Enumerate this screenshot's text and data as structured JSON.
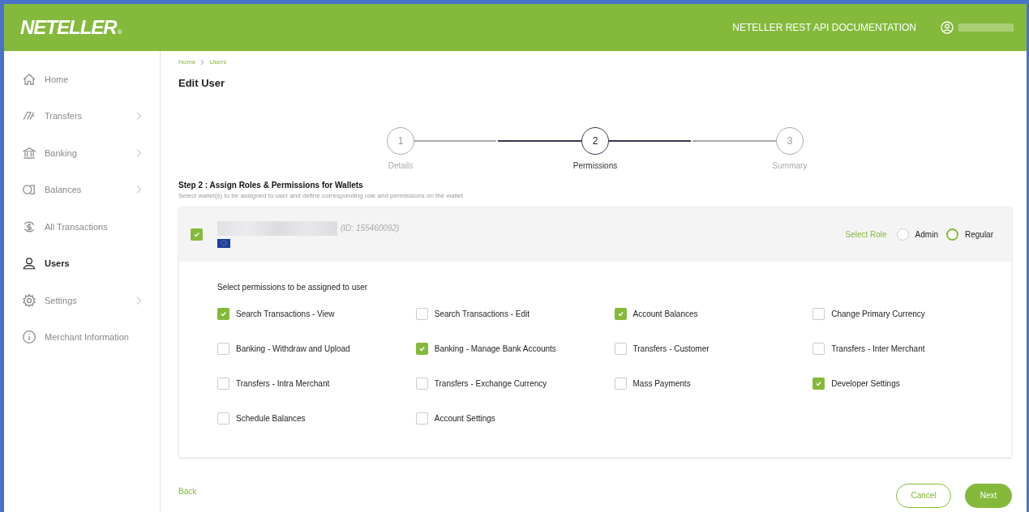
{
  "header": {
    "logo": "NETELLER",
    "logo_mark": "®",
    "doc_link": "NETELLER REST API DOCUMENTATION"
  },
  "sidebar": {
    "items": [
      {
        "label": "Home",
        "expandable": false,
        "selected": false
      },
      {
        "label": "Transfers",
        "expandable": true,
        "selected": false
      },
      {
        "label": "Banking",
        "expandable": true,
        "selected": false
      },
      {
        "label": "Balances",
        "expandable": true,
        "selected": false
      },
      {
        "label": "All Transactions",
        "expandable": false,
        "selected": false
      },
      {
        "label": "Users",
        "expandable": false,
        "selected": true
      },
      {
        "label": "Settings",
        "expandable": true,
        "selected": false
      },
      {
        "label": "Merchant Information",
        "expandable": false,
        "selected": false
      }
    ]
  },
  "breadcrumb": [
    "Home",
    "Users"
  ],
  "page_title": "Edit User",
  "stepper": [
    {
      "number": "1",
      "label": "Details",
      "selected": false
    },
    {
      "number": "2",
      "label": "Permissions",
      "selected": true
    },
    {
      "number": "3",
      "label": "Summary",
      "selected": false
    }
  ],
  "section": {
    "title": "Step 2 : Assign Roles & Permissions for Wallets",
    "subtitle": "Select wallet(s) to be assigned to user and define corresponding role and permissions on the wallet"
  },
  "wallet": {
    "checked": true,
    "id_text": "(ID: 155460092)",
    "role_label": "Select Role",
    "roles": [
      {
        "label": "Admin",
        "selected": false
      },
      {
        "label": "Regular",
        "selected": true
      }
    ],
    "permissions_title": "Select permissions to be assigned to user",
    "permissions": [
      {
        "label": "Search Transactions - View",
        "checked": true
      },
      {
        "label": "Search Transactions - Edit",
        "checked": false
      },
      {
        "label": "Account Balances",
        "checked": true
      },
      {
        "label": "Change Primary Currency",
        "checked": false
      },
      {
        "label": "Banking - Withdraw and Upload",
        "checked": false
      },
      {
        "label": "Banking - Manage Bank Accounts",
        "checked": true
      },
      {
        "label": "Transfers - Customer",
        "checked": false
      },
      {
        "label": "Transfers - Inter Merchant",
        "checked": false
      },
      {
        "label": "Transfers - Intra Merchant",
        "checked": false
      },
      {
        "label": "Transfers - Exchange Currency",
        "checked": false
      },
      {
        "label": "Mass Payments",
        "checked": false
      },
      {
        "label": "Developer Settings",
        "checked": true
      },
      {
        "label": "Schedule Balances",
        "checked": false
      },
      {
        "label": "Account Settings",
        "checked": false
      }
    ]
  },
  "footer": {
    "back": "Back",
    "cancel": "Cancel",
    "next": "Next"
  }
}
